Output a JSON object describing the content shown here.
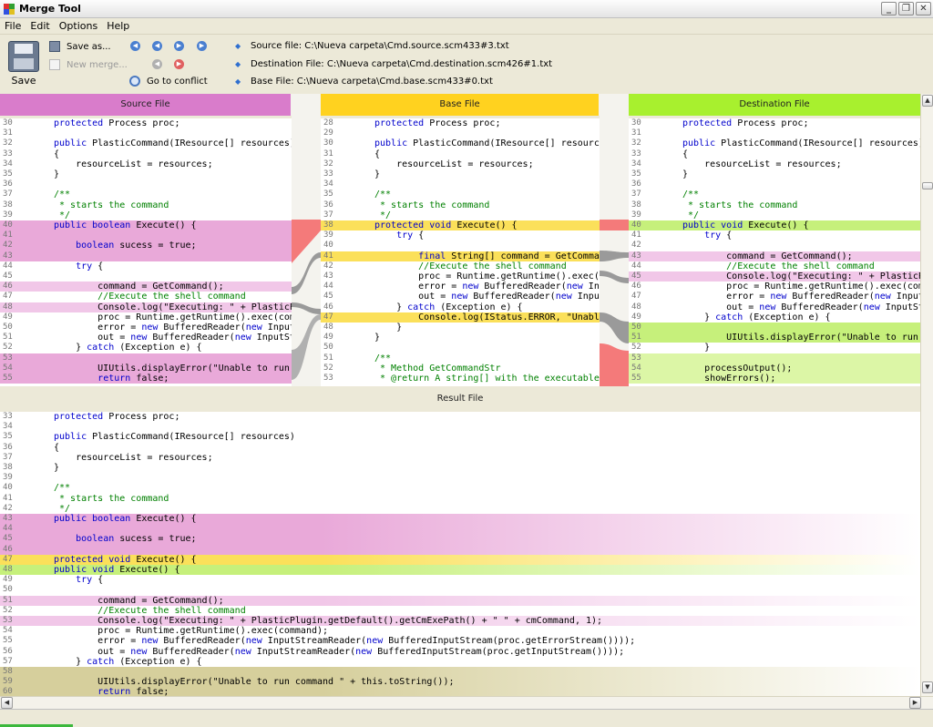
{
  "window": {
    "title": "Merge Tool"
  },
  "menu": [
    "File",
    "Edit",
    "Options",
    "Help"
  ],
  "toolbar": {
    "save_label": "Save",
    "save_as_label": "Save as...",
    "new_merge_label": "New merge...",
    "go_to_conflict_label": "Go to conflict",
    "source_file_label": "Source file: C:\\Nueva carpeta\\Cmd.source.scm433#3.txt",
    "destination_file_label": "Destination File: C:\\Nueva carpeta\\Cmd.destination.scm426#1.txt",
    "base_file_label": "Base File: C:\\Nueva carpeta\\Cmd.base.scm433#0.txt"
  },
  "panes": {
    "source": {
      "title": "Source File",
      "color": "#d97ccb"
    },
    "base": {
      "title": "Base File",
      "color": "#ffd21f"
    },
    "destination": {
      "title": "Destination File",
      "color": "#a8f02e"
    },
    "result": {
      "title": "Result File"
    }
  },
  "source_lines": [
    {
      "n": "30",
      "t": "protected Process proc;",
      "h": ""
    },
    {
      "n": "31",
      "t": "",
      "h": ""
    },
    {
      "n": "32",
      "t": "public PlasticCommand(IResource[] resources)",
      "h": ""
    },
    {
      "n": "33",
      "t": "{",
      "h": ""
    },
    {
      "n": "34",
      "t": "    resourceList = resources;",
      "h": ""
    },
    {
      "n": "35",
      "t": "}",
      "h": ""
    },
    {
      "n": "36",
      "t": "",
      "h": ""
    },
    {
      "n": "37",
      "t": "/**",
      "h": "",
      "c": "cm"
    },
    {
      "n": "38",
      "t": " * starts the command",
      "h": "",
      "c": "cm"
    },
    {
      "n": "39",
      "t": " */",
      "h": "",
      "c": "cm"
    },
    {
      "n": "40",
      "t": "public boolean Execute() {",
      "h": "pink"
    },
    {
      "n": "41",
      "t": "",
      "h": "pink"
    },
    {
      "n": "42",
      "t": "    boolean sucess = true;",
      "h": "pink"
    },
    {
      "n": "43",
      "t": "",
      "h": "pink"
    },
    {
      "n": "44",
      "t": "    try {",
      "h": ""
    },
    {
      "n": "45",
      "t": "",
      "h": ""
    },
    {
      "n": "46",
      "t": "        command = GetCommand();",
      "h": "pinkl"
    },
    {
      "n": "47",
      "t": "        //Execute the shell command",
      "h": "",
      "c": "cm"
    },
    {
      "n": "48",
      "t": "        Console.log(\"Executing: \" + PlasticPlugin",
      "h": "pinkl"
    },
    {
      "n": "49",
      "t": "        proc = Runtime.getRuntime().exec(command);",
      "h": ""
    },
    {
      "n": "50",
      "t": "        error = new BufferedReader(new InputStream",
      "h": ""
    },
    {
      "n": "51",
      "t": "        out = new BufferedReader(new InputStream",
      "h": ""
    },
    {
      "n": "52",
      "t": "    } catch (Exception e) {",
      "h": ""
    },
    {
      "n": "53",
      "t": "",
      "h": "pink"
    },
    {
      "n": "54",
      "t": "        UIUtils.displayError(\"Unable to run",
      "h": "pink"
    },
    {
      "n": "55",
      "t": "        return false;",
      "h": "pink"
    }
  ],
  "base_lines": [
    {
      "n": "28",
      "t": "protected Process proc;",
      "h": ""
    },
    {
      "n": "29",
      "t": "",
      "h": ""
    },
    {
      "n": "30",
      "t": "public PlasticCommand(IResource[] resources)",
      "h": ""
    },
    {
      "n": "31",
      "t": "{",
      "h": ""
    },
    {
      "n": "32",
      "t": "    resourceList = resources;",
      "h": ""
    },
    {
      "n": "33",
      "t": "}",
      "h": ""
    },
    {
      "n": "34",
      "t": "",
      "h": ""
    },
    {
      "n": "35",
      "t": "/**",
      "h": "",
      "c": "cm"
    },
    {
      "n": "36",
      "t": " * starts the command",
      "h": "",
      "c": "cm"
    },
    {
      "n": "37",
      "t": " */",
      "h": "",
      "c": "cm"
    },
    {
      "n": "38",
      "t": "protected void Execute() {",
      "h": "yellow"
    },
    {
      "n": "39",
      "t": "    try {",
      "h": ""
    },
    {
      "n": "40",
      "t": "",
      "h": ""
    },
    {
      "n": "41",
      "t": "        final String[] command = GetCommand();",
      "h": "yellow"
    },
    {
      "n": "42",
      "t": "        //Execute the shell command",
      "h": "",
      "c": "cm"
    },
    {
      "n": "43",
      "t": "        proc = Runtime.getRuntime().exec(command);",
      "h": ""
    },
    {
      "n": "44",
      "t": "        error = new BufferedReader(new InputStream",
      "h": ""
    },
    {
      "n": "45",
      "t": "        out = new BufferedReader(new InputStream",
      "h": ""
    },
    {
      "n": "46",
      "t": "    } catch (Exception e) {",
      "h": ""
    },
    {
      "n": "47",
      "t": "        Console.log(IStatus.ERROR, \"Unable",
      "h": "yellow"
    },
    {
      "n": "48",
      "t": "    }",
      "h": ""
    },
    {
      "n": "49",
      "t": "}",
      "h": ""
    },
    {
      "n": "50",
      "t": "",
      "h": ""
    },
    {
      "n": "51",
      "t": "/**",
      "h": "",
      "c": "cm"
    },
    {
      "n": "52",
      "t": " * Method GetCommandStr",
      "h": "",
      "c": "cm"
    },
    {
      "n": "53",
      "t": " * @return A string[] with the executable",
      "h": "",
      "c": "cm"
    }
  ],
  "destination_lines": [
    {
      "n": "30",
      "t": "protected Process proc;",
      "h": ""
    },
    {
      "n": "31",
      "t": "",
      "h": ""
    },
    {
      "n": "32",
      "t": "public PlasticCommand(IResource[] resources)",
      "h": ""
    },
    {
      "n": "33",
      "t": "{",
      "h": ""
    },
    {
      "n": "34",
      "t": "    resourceList = resources;",
      "h": ""
    },
    {
      "n": "35",
      "t": "}",
      "h": ""
    },
    {
      "n": "36",
      "t": "",
      "h": ""
    },
    {
      "n": "37",
      "t": "/**",
      "h": "",
      "c": "cm"
    },
    {
      "n": "38",
      "t": " * starts the command",
      "h": "",
      "c": "cm"
    },
    {
      "n": "39",
      "t": " */",
      "h": "",
      "c": "cm"
    },
    {
      "n": "40",
      "t": "public void Execute() {",
      "h": "green"
    },
    {
      "n": "41",
      "t": "    try {",
      "h": ""
    },
    {
      "n": "42",
      "t": "",
      "h": ""
    },
    {
      "n": "43",
      "t": "        command = GetCommand();",
      "h": "pinkl"
    },
    {
      "n": "44",
      "t": "        //Execute the shell command",
      "h": "",
      "c": "cm"
    },
    {
      "n": "45",
      "t": "        Console.log(\"Executing: \" + PlasticPlugin",
      "h": "pinkl"
    },
    {
      "n": "46",
      "t": "        proc = Runtime.getRuntime().exec(command);",
      "h": ""
    },
    {
      "n": "47",
      "t": "        error = new BufferedReader(new InputStream",
      "h": ""
    },
    {
      "n": "48",
      "t": "        out = new BufferedReader(new InputStream",
      "h": ""
    },
    {
      "n": "49",
      "t": "    } catch (Exception e) {",
      "h": ""
    },
    {
      "n": "50",
      "t": "",
      "h": "green"
    },
    {
      "n": "51",
      "t": "        UIUtils.displayError(\"Unable to run",
      "h": "green"
    },
    {
      "n": "52",
      "t": "    }",
      "h": ""
    },
    {
      "n": "53",
      "t": "",
      "h": "greenl"
    },
    {
      "n": "54",
      "t": "    processOutput();",
      "h": "greenl"
    },
    {
      "n": "55",
      "t": "    showErrors();",
      "h": "greenl"
    }
  ],
  "result_lines": [
    {
      "n": "33",
      "t": "protected Process proc;",
      "h": ""
    },
    {
      "n": "34",
      "t": "",
      "h": ""
    },
    {
      "n": "35",
      "t": "public PlasticCommand(IResource[] resources)",
      "h": ""
    },
    {
      "n": "36",
      "t": "{",
      "h": ""
    },
    {
      "n": "37",
      "t": "    resourceList = resources;",
      "h": ""
    },
    {
      "n": "38",
      "t": "}",
      "h": ""
    },
    {
      "n": "39",
      "t": "",
      "h": ""
    },
    {
      "n": "40",
      "t": "/**",
      "h": "",
      "c": "cm"
    },
    {
      "n": "41",
      "t": " * starts the command",
      "h": "",
      "c": "cm"
    },
    {
      "n": "42",
      "t": " */",
      "h": "",
      "c": "cm"
    },
    {
      "n": "43",
      "t": "public boolean Execute() {",
      "h": "pink"
    },
    {
      "n": "44",
      "t": "",
      "h": "pink"
    },
    {
      "n": "45",
      "t": "    boolean sucess = true;",
      "h": "pink"
    },
    {
      "n": "46",
      "t": "",
      "h": "pink"
    },
    {
      "n": "47",
      "t": "protected void Execute() {",
      "h": "yellow"
    },
    {
      "n": "48",
      "t": "public void Execute() {",
      "h": "green"
    },
    {
      "n": "49",
      "t": "    try {",
      "h": ""
    },
    {
      "n": "50",
      "t": "",
      "h": ""
    },
    {
      "n": "51",
      "t": "        command = GetCommand();",
      "h": "pinkl"
    },
    {
      "n": "52",
      "t": "        //Execute the shell command",
      "h": "",
      "c": "cm"
    },
    {
      "n": "53",
      "t": "        Console.log(\"Executing: \" + PlasticPlugin.getDefault().getCmExePath() + \" \" + cmCommand, 1);",
      "h": "pinkl"
    },
    {
      "n": "54",
      "t": "        proc = Runtime.getRuntime().exec(command);",
      "h": ""
    },
    {
      "n": "55",
      "t": "        error = new BufferedReader(new InputStreamReader(new BufferedInputStream(proc.getErrorStream())));",
      "h": ""
    },
    {
      "n": "56",
      "t": "        out = new BufferedReader(new InputStreamReader(new BufferedInputStream(proc.getInputStream())));",
      "h": ""
    },
    {
      "n": "57",
      "t": "    } catch (Exception e) {",
      "h": ""
    },
    {
      "n": "58",
      "t": "",
      "h": "olive"
    },
    {
      "n": "59",
      "t": "        UIUtils.displayError(\"Unable to run command \" + this.toString());",
      "h": "olive"
    },
    {
      "n": "60",
      "t": "        return false;",
      "h": "olive"
    }
  ]
}
